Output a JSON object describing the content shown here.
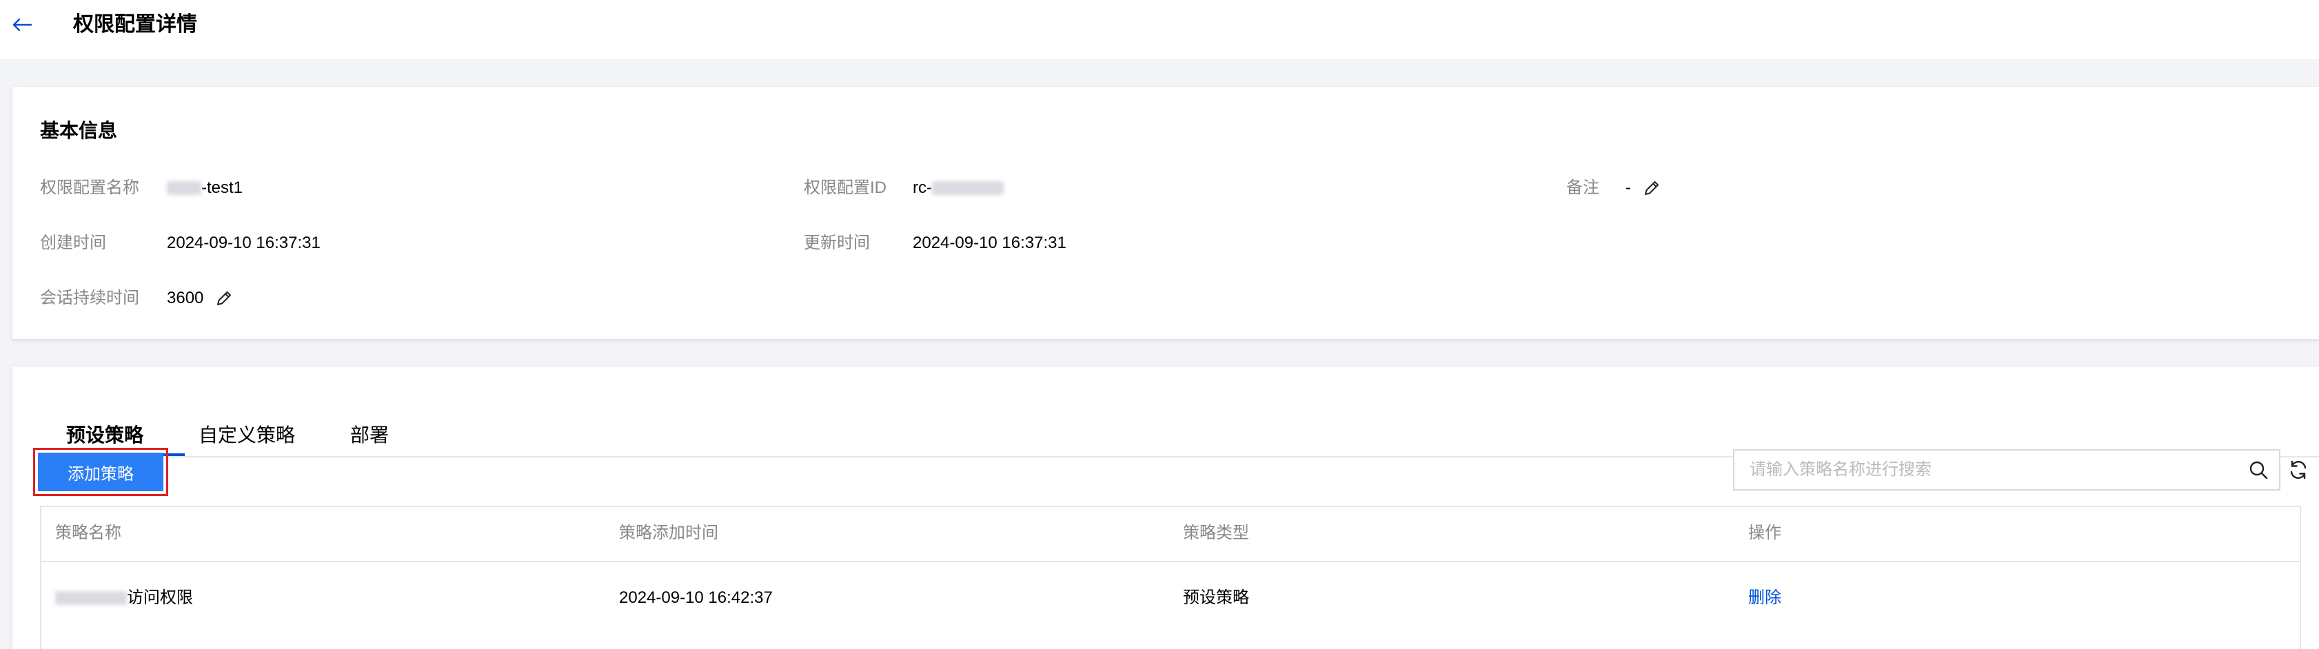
{
  "header": {
    "title": "权限配置详情"
  },
  "basic_info": {
    "title": "基本信息",
    "name_label": "权限配置名称",
    "name_value": "-test1",
    "id_label": "权限配置ID",
    "id_value": "rc-",
    "remark_label": "备注",
    "remark_value": "-",
    "created_label": "创建时间",
    "created_value": "2024-09-10 16:37:31",
    "updated_label": "更新时间",
    "updated_value": "2024-09-10 16:37:31",
    "duration_label": "会话持续时间",
    "duration_value": "3600"
  },
  "tabs": [
    {
      "label": "预设策略",
      "active": true
    },
    {
      "label": "自定义策略",
      "active": false
    },
    {
      "label": "部署",
      "active": false
    }
  ],
  "toolbar": {
    "add_label": "添加策略",
    "search_placeholder": "请输入策略名称进行搜索"
  },
  "table": {
    "columns": [
      "策略名称",
      "策略添加时间",
      "策略类型",
      "操作"
    ],
    "rows": [
      {
        "name": "访问权限",
        "added_time": "2024-09-10 16:42:37",
        "type": "预设策略",
        "action": "删除"
      }
    ]
  },
  "colors": {
    "primary": "#2b7ff6",
    "link": "#0052d9",
    "highlight_border": "#e02020",
    "background": "#f3f4f7"
  }
}
